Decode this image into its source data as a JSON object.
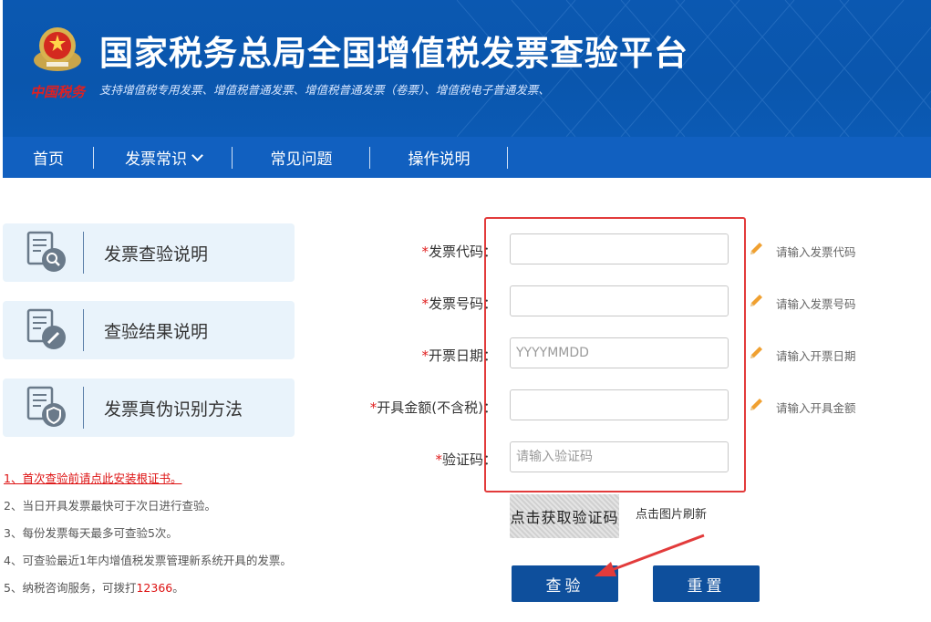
{
  "header": {
    "title": "国家税务总局全国增值税发票查验平台",
    "subtitle": "支持增值税专用发票、增值税普通发票、增值税普通发票（卷票）、增值税电子普通发票、",
    "signature": "中国税务"
  },
  "nav": {
    "items": [
      {
        "label": "首页"
      },
      {
        "label": "发票常识",
        "dropdown": true
      },
      {
        "label": "常见问题"
      },
      {
        "label": "操作说明"
      }
    ]
  },
  "cards": [
    {
      "label": "发票查验说明",
      "icon": "magnifier-document-icon"
    },
    {
      "label": "查验结果说明",
      "icon": "pencil-document-icon"
    },
    {
      "label": "发票真伪识别方法",
      "icon": "shield-document-icon"
    }
  ],
  "notes": {
    "n1": "1、首次查验前请点此安装根证书。",
    "n2": "2、当日开具发票最快可于次日进行查验。",
    "n3": "3、每份发票每天最多可查验5次。",
    "n4": "4、可查验最近1年内增值税发票管理新系统开具的发票。",
    "n5_prefix": "5、纳税咨询服务，可拨打",
    "n5_phone": "12366",
    "n5_suffix": "。"
  },
  "form": {
    "required_mark": "*",
    "colon": "：",
    "invoice_code": {
      "label": "发票代码",
      "value": "",
      "placeholder": "",
      "hint": "请输入发票代码"
    },
    "invoice_number": {
      "label": "发票号码",
      "value": "",
      "placeholder": "",
      "hint": "请输入发票号码"
    },
    "issue_date": {
      "label": "开票日期",
      "value": "",
      "placeholder": "YYYYMMDD",
      "hint": "请输入开票日期"
    },
    "amount": {
      "label": "开具金额(不含税)",
      "value": "",
      "placeholder": "",
      "hint": "请输入开具金额"
    },
    "captcha": {
      "label": "验证码",
      "value": "",
      "placeholder": "请输入验证码"
    },
    "captcha_image_text": "点击获取验证码",
    "captcha_refresh": "点击图片刷新"
  },
  "buttons": {
    "check": "查验",
    "reset": "重置"
  },
  "colors": {
    "banner": "#0b58b1",
    "nav": "#1160c0",
    "button": "#0e4f9c",
    "highlight": "#e23b3b"
  }
}
